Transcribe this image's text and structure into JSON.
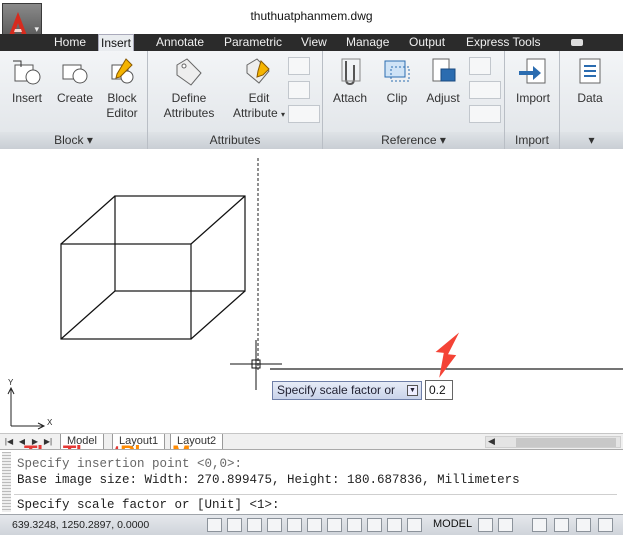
{
  "window": {
    "title": "thuthuatphanmem.dwg"
  },
  "tabs": [
    "Home",
    "Insert",
    "Annotate",
    "Parametric",
    "View",
    "Manage",
    "Output",
    "Express Tools"
  ],
  "active_tab": "Insert",
  "ribbon": {
    "block_panel": {
      "title": "Block",
      "buttons": {
        "insert": "Insert",
        "create": "Create",
        "block_editor_1": "Block",
        "block_editor_2": "Editor"
      }
    },
    "attributes_panel": {
      "title": "Attributes",
      "buttons": {
        "define_1": "Define",
        "define_2": "Attributes",
        "edit_1": "Edit",
        "edit_2": "Attribute"
      }
    },
    "reference_panel": {
      "title": "Reference",
      "buttons": {
        "attach": "Attach",
        "clip": "Clip",
        "adjust": "Adjust"
      }
    },
    "import_panel": {
      "title": "Import",
      "buttons": {
        "import": "Import"
      }
    },
    "data_panel": {
      "buttons": {
        "data": "Data"
      }
    }
  },
  "drawing": {
    "ucs_y": "Y",
    "ucs_x": "X"
  },
  "dynamic_input": {
    "prompt": "Specify scale factor or",
    "value": "0.2"
  },
  "layout_tabs": [
    "Model",
    "Layout1",
    "Layout2"
  ],
  "command": {
    "line1": "Specify insertion point <0,0>:",
    "line2": "Base image size: Width: 270.899475, Height: 180.687836, Millimeters",
    "line3": "Specify scale factor or [Unit] <1>:"
  },
  "statusbar": {
    "coords": "639.3248, 1250.2897, 0.0000",
    "model_label": "MODEL"
  },
  "watermark": {
    "part1": "ThuThuat",
    "part2": "PhanMem",
    "part3": ".vn"
  },
  "colors": {
    "accent_red": "#e53935",
    "ribbon_bg": "#e8ebee",
    "tab_bar": "#2b2b2b"
  }
}
